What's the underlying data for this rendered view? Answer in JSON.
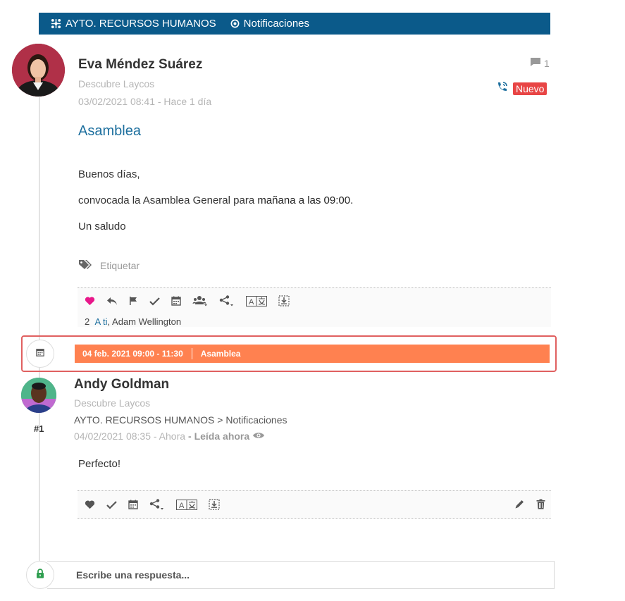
{
  "header": {
    "group": "AYTO. RECURSOS HUMANOS",
    "channel": "Notificaciones"
  },
  "post": {
    "author": "Eva Méndez Suárez",
    "source": "Descubre Laycos",
    "datetime": "03/02/2021 08:41 - Hace 1 día",
    "comment_count": "1",
    "badge": "Nuevo",
    "title": "Asamblea",
    "body": {
      "line1": "Buenos días,",
      "line2_prefix": "convocada la Asamblea General para ",
      "line2_highlight": "mañana a las 09:00.",
      "line3": "Un saludo"
    },
    "tag_label": "Etiquetar",
    "likes": {
      "count": "2",
      "you": "A ti",
      "others": ", Adam Wellington"
    }
  },
  "event": {
    "datetime": "04 feb. 2021 09:00 - 11:30",
    "title": "Asamblea"
  },
  "reply": {
    "author": "Andy Goldman",
    "number": "#1",
    "source": "Descubre Laycos",
    "path": "AYTO. RECURSOS HUMANOS > Notificaciones",
    "datetime": "04/02/2021 08:35 - Ahora",
    "read_status": "- Leída ahora",
    "body": "Perfecto!"
  },
  "reply_box": {
    "placeholder": "Escribe una respuesta..."
  },
  "colors": {
    "header_bg": "#0b5a8a",
    "accent_link": "#1d6f9e",
    "badge_red": "#e84545",
    "event_orange": "#ff8150",
    "like_pink": "#e8178a",
    "lock_green": "#2e9e4f",
    "highlight_border": "#e06060"
  },
  "icons": {
    "header_group": "network-icon",
    "header_channel": "target-icon",
    "post_actions": [
      "heart-icon",
      "reply-icon",
      "flag-icon",
      "check-icon",
      "calendar-icon",
      "group-icon",
      "share-icon",
      "translate-icon",
      "download-box-icon"
    ],
    "reply_actions": [
      "heart-icon",
      "check-icon",
      "calendar-icon",
      "share-icon",
      "translate-icon",
      "download-box-icon",
      "edit-icon",
      "trash-icon"
    ]
  }
}
